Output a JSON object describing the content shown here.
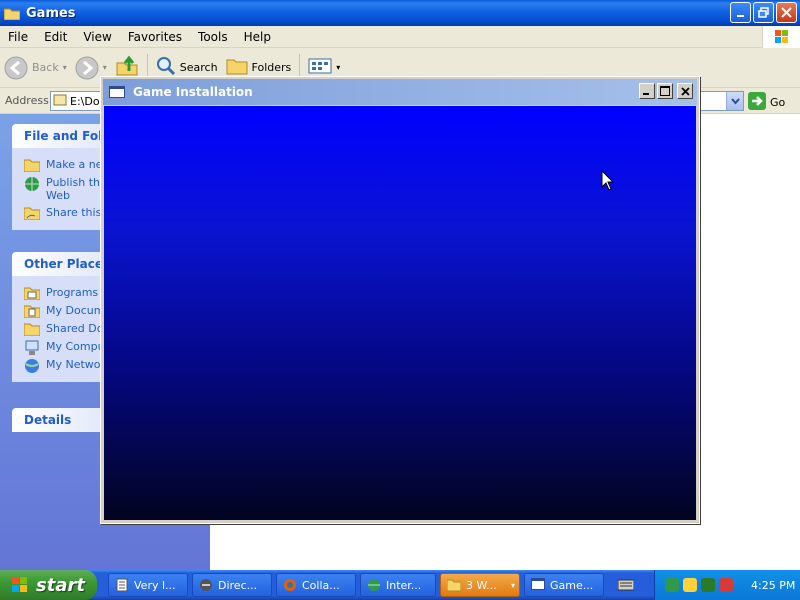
{
  "explorer": {
    "title": "Games",
    "menu": [
      "File",
      "Edit",
      "View",
      "Favorites",
      "Tools",
      "Help"
    ],
    "toolbar": {
      "back": "Back",
      "search": "Search",
      "folders": "Folders"
    },
    "address": {
      "label": "Address",
      "value": "E:\\Do",
      "go": "Go"
    },
    "task_pane": {
      "file_folder": {
        "title": "File and Folde",
        "items": [
          "Make a ne",
          "Publish this\nWeb",
          "Share this"
        ]
      },
      "other_places": {
        "title": "Other Places",
        "items": [
          "Programs",
          "My Docume",
          "Shared Do",
          "My Compu",
          "My Networ"
        ]
      },
      "details": {
        "title": "Details"
      }
    }
  },
  "game_window": {
    "title": "Game Installation",
    "gradient_top": "#0000ff",
    "gradient_bottom": "#020420"
  },
  "taskbar": {
    "start": "start",
    "buttons": [
      "Very l...",
      "Direc...",
      "Colla...",
      "Inter...",
      "3 W...",
      "Game..."
    ],
    "clock": "4:25 PM"
  }
}
